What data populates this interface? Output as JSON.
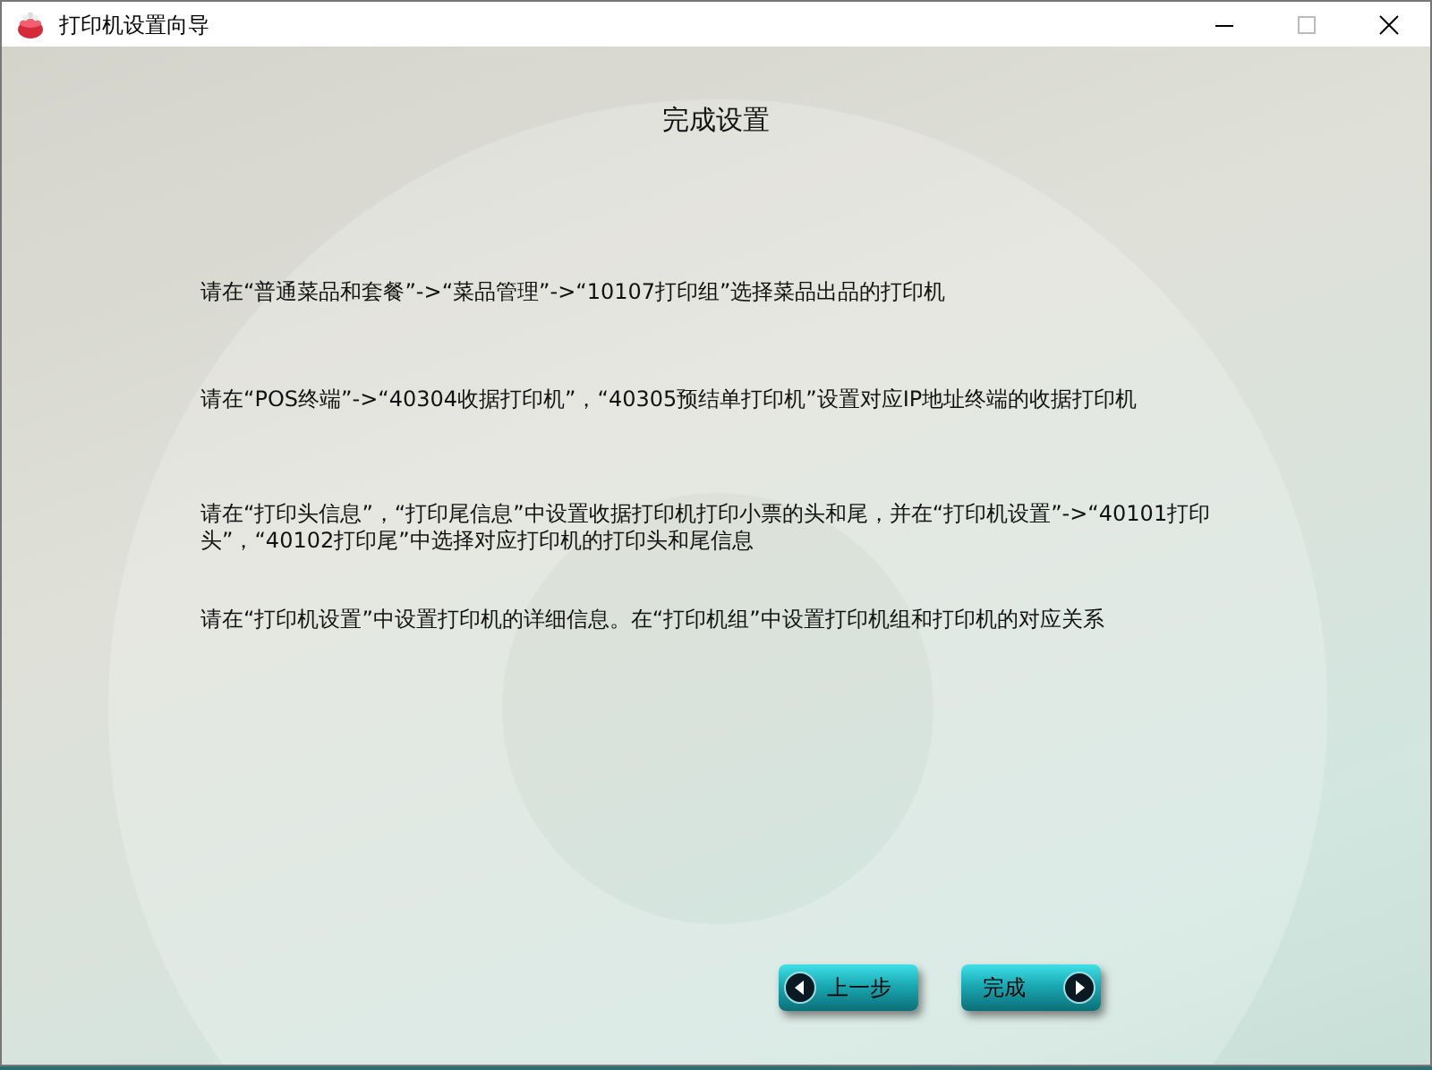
{
  "window": {
    "title": "打印机设置向导"
  },
  "heading": "完成设置",
  "instructions": [
    "请在“普通菜品和套餐”->“菜品管理”->“10107打印组”选择菜品出品的打印机",
    "请在“POS终端”->“40304收据打印机”，“40305预结单打印机”设置对应IP地址终端的收据打印机",
    "请在“打印头信息”，“打印尾信息”中设置收据打印机打印小票的头和尾，并在“打印机设置”->“40101打印头”，“40102打印尾”中选择对应打印机的打印头和尾信息",
    "请在“打印机设置”中设置打印机的详细信息。在“打印机组”中设置打印机组和打印机的对应关系"
  ],
  "buttons": [
    {
      "label": "上一步",
      "kind": "back"
    },
    {
      "label": "完成",
      "kind": "next"
    }
  ]
}
